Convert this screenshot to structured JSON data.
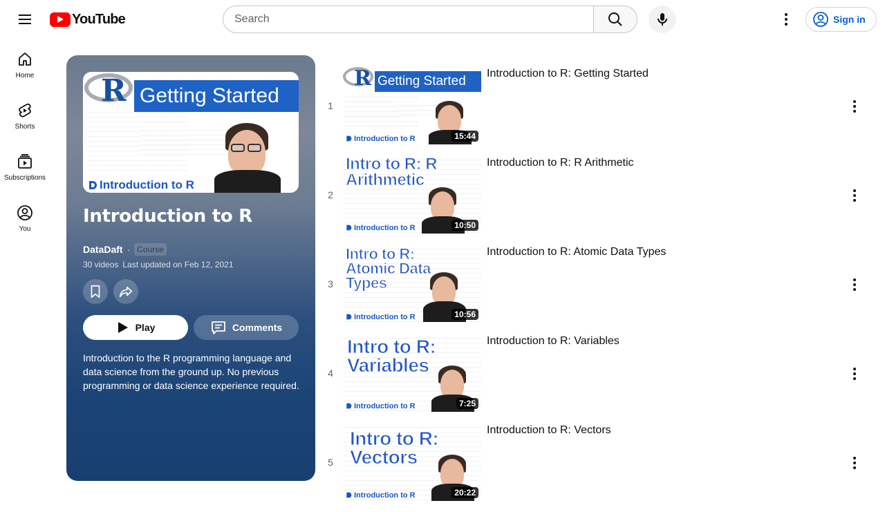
{
  "topbar": {
    "logo_text": "YouTube",
    "search_placeholder": "Search",
    "signin_label": "Sign in"
  },
  "leftnav": {
    "items": [
      {
        "label": "Home",
        "icon": "home-icon"
      },
      {
        "label": "Shorts",
        "icon": "shorts-icon"
      },
      {
        "label": "Subscriptions",
        "icon": "subscriptions-icon"
      },
      {
        "label": "You",
        "icon": "you-icon"
      }
    ]
  },
  "playlist": {
    "title": "Introduction to R",
    "thumb_banner": "Getting Started",
    "thumb_tag": "Introduction to R",
    "owner": "DataDaft",
    "separator": "·",
    "badge": "Course",
    "video_count": "30 videos",
    "updated": "Last updated on Feb 12, 2021",
    "play_label": "Play",
    "comments_label": "Comments",
    "description": "Introduction to the R programming language and data science from the ground up. No previous programming or data science experience required."
  },
  "videos": [
    {
      "index": "1",
      "title": "Introduction to R: Getting Started",
      "duration": "15:44",
      "thumb_text": "Getting Started",
      "thumb_tag": "Introduction to R"
    },
    {
      "index": "2",
      "title": "Introduction to R: R Arithmetic",
      "duration": "10:50",
      "thumb_text": "Intro to R: R Arithmetic",
      "thumb_tag": "Introduction to R"
    },
    {
      "index": "3",
      "title": "Introduction to R: Atomic Data Types",
      "duration": "10:56",
      "thumb_text": "Intro to R: Atomic Data Types",
      "thumb_tag": "Introduction to R"
    },
    {
      "index": "4",
      "title": "Introduction to R: Variables",
      "duration": "7:25",
      "thumb_text": "Intro to R: Variables",
      "thumb_tag": "Introduction to R"
    },
    {
      "index": "5",
      "title": "Introduction to R: Vectors",
      "duration": "20:22",
      "thumb_text": "Intro to R: Vectors",
      "thumb_tag": "Introduction to R"
    }
  ],
  "colors": {
    "brand_red": "#ff0000",
    "link_blue": "#065fd4",
    "card_dark": "#17406f"
  }
}
